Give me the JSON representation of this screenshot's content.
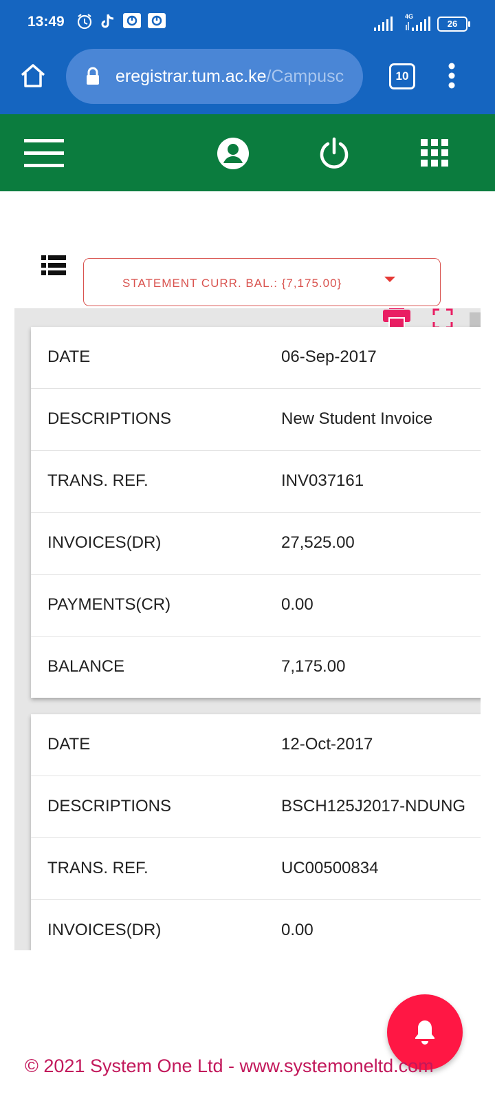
{
  "status_bar": {
    "time": "13:49",
    "network": "4G",
    "battery": "26",
    "icons": [
      "alarm-icon",
      "tiktok-icon",
      "app-notification-icon",
      "app-notification-icon",
      "signal-icon",
      "signal-4g-icon",
      "battery-icon"
    ]
  },
  "browser": {
    "url_host": "eregistrar.tum.ac.ke",
    "url_path": "/Campusc",
    "tab_count": "10",
    "icons": [
      "home-icon",
      "lock-icon",
      "tabs-icon",
      "more-vert-icon"
    ]
  },
  "app_header": {
    "background": "#0b7c3e",
    "icons": [
      "menu-icon",
      "account-icon",
      "power-icon",
      "apps-grid-icon"
    ]
  },
  "statement": {
    "select_label": "STATEMENT CURR. BAL.: {7,175.00}",
    "accent": "#d9534f",
    "records": [
      {
        "rows": [
          {
            "label": "DATE",
            "value": "06-Sep-2017"
          },
          {
            "label": "DESCRIPTIONS",
            "value": "New Student Invoice"
          },
          {
            "label": "TRANS. REF.",
            "value": "INV037161"
          },
          {
            "label": "INVOICES(DR)",
            "value": "27,525.00"
          },
          {
            "label": "PAYMENTS(CR)",
            "value": "0.00"
          },
          {
            "label": "BALANCE",
            "value": "7,175.00"
          }
        ]
      },
      {
        "rows": [
          {
            "label": "DATE",
            "value": "12-Oct-2017"
          },
          {
            "label": "DESCRIPTIONS",
            "value": "BSCH125J2017-NDUNG"
          },
          {
            "label": "TRANS. REF.",
            "value": "UC00500834"
          },
          {
            "label": "INVOICES(DR)",
            "value": "0.00"
          }
        ]
      }
    ]
  },
  "fab": {
    "icon": "bell-icon",
    "color": "#ff1744"
  },
  "footer": {
    "text": "© 2021 System One Ltd - www.systemoneltd.com",
    "color": "#c2185b"
  }
}
